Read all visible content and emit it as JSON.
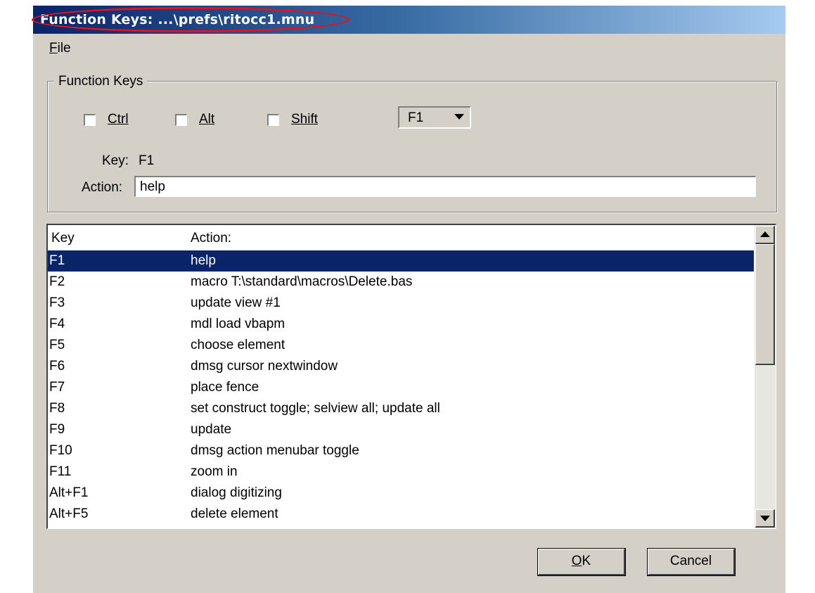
{
  "window": {
    "title": "Function Keys: ...\\prefs\\ritocc1.mnu"
  },
  "menubar": {
    "file_prefix": "F",
    "file_rest": "ile"
  },
  "group": {
    "legend": "Function Keys",
    "ctrl_label": "Ctrl",
    "alt_label": "Alt",
    "shift_label": "Shift",
    "ctrl_checked": false,
    "alt_checked": false,
    "shift_checked": false,
    "key_select_value": "F1",
    "key_caption": "Key:",
    "key_value": "F1",
    "action_caption": "Action:",
    "action_value": "help"
  },
  "list": {
    "columns": [
      "Key",
      "Action:"
    ],
    "selected_index": 0,
    "rows": [
      {
        "key": "F1",
        "action": "help"
      },
      {
        "key": "F2",
        "action": "macro T:\\standard\\macros\\Delete.bas"
      },
      {
        "key": "F3",
        "action": "update view #1"
      },
      {
        "key": "F4",
        "action": "mdl load vbapm"
      },
      {
        "key": "F5",
        "action": "choose element"
      },
      {
        "key": "F6",
        "action": "dmsg cursor nextwindow"
      },
      {
        "key": "F7",
        "action": "place fence"
      },
      {
        "key": "F8",
        "action": "set construct toggle; selview all; update all"
      },
      {
        "key": "F9",
        "action": "update"
      },
      {
        "key": "F10",
        "action": "dmsg action menubar toggle"
      },
      {
        "key": "F11",
        "action": "zoom in"
      },
      {
        "key": "Alt+F1",
        "action": "dialog digitizing"
      },
      {
        "key": "Alt+F5",
        "action": "delete element"
      }
    ]
  },
  "buttons": {
    "ok_prefix": "O",
    "ok_rest": "K",
    "cancel": "Cancel"
  },
  "colors": {
    "face": "#d4d0c8",
    "selection": "#0a246a",
    "title_start": "#0a246a",
    "title_end": "#a6caf0",
    "highlight_ellipse": "#e8101a"
  }
}
